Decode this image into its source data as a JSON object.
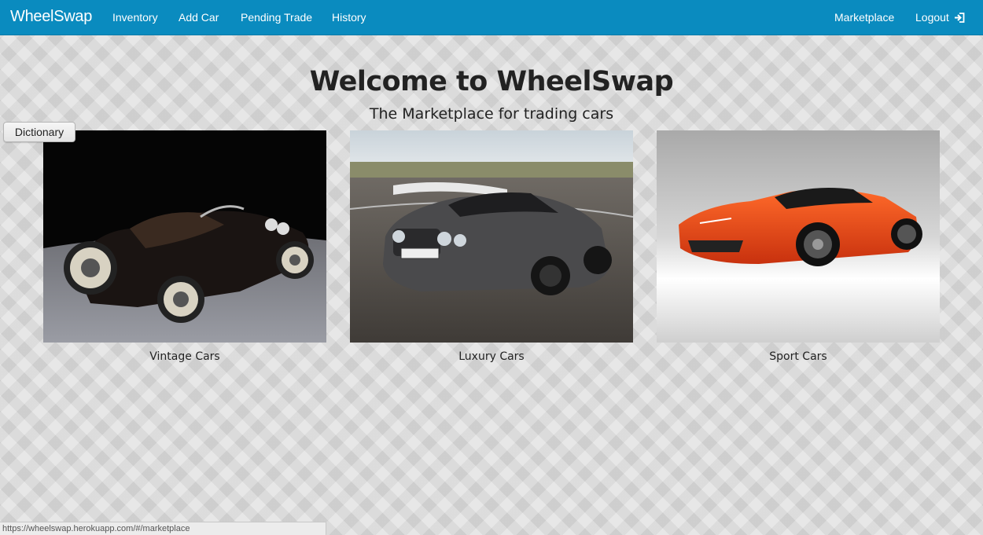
{
  "navbar": {
    "brand": "WheelSwap",
    "links": [
      {
        "label": "Inventory"
      },
      {
        "label": "Add Car"
      },
      {
        "label": "Pending Trade"
      },
      {
        "label": "History"
      }
    ],
    "right_links": [
      {
        "label": "Marketplace"
      },
      {
        "label": "Logout",
        "icon": "logout-icon"
      }
    ],
    "color": "#0a8bbf"
  },
  "hero": {
    "title": "Welcome to WheelSwap",
    "subtitle": "The Marketplace for trading cars"
  },
  "dictionary_button": {
    "label": "Dictionary"
  },
  "categories": [
    {
      "caption": "Vintage Cars"
    },
    {
      "caption": "Luxury Cars"
    },
    {
      "caption": "Sport Cars"
    }
  ],
  "status_bar": {
    "url": "https://wheelswap.herokuapp.com/#/marketplace"
  }
}
